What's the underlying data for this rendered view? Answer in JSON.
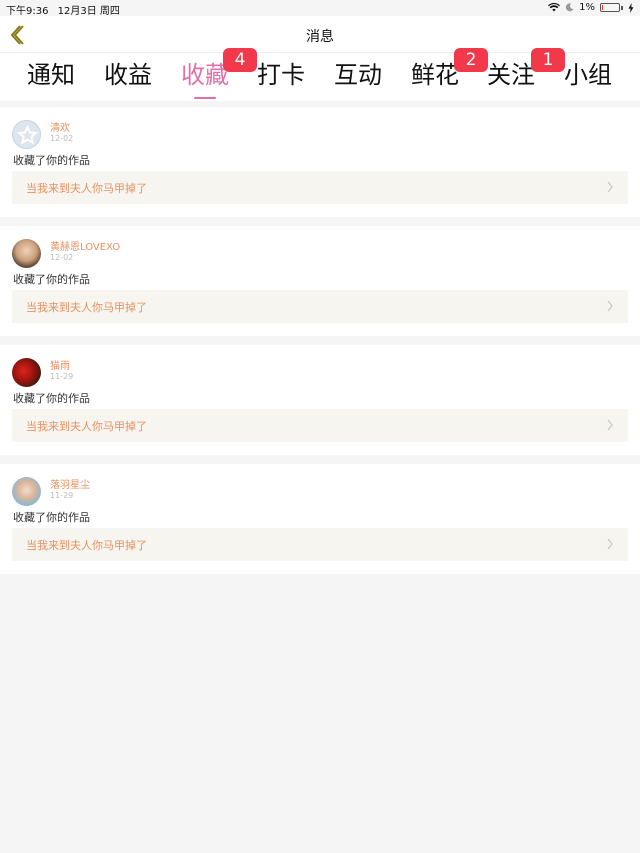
{
  "status": {
    "time": "下午9:36",
    "date": "12月3日 周四",
    "battery": "1%"
  },
  "nav": {
    "title": "消息"
  },
  "tabs": [
    {
      "label": "通知",
      "badge": null
    },
    {
      "label": "收益",
      "badge": null
    },
    {
      "label": "收藏",
      "badge": "4",
      "active": true
    },
    {
      "label": "打卡",
      "badge": null
    },
    {
      "label": "互动",
      "badge": null
    },
    {
      "label": "鲜花",
      "badge": "2"
    },
    {
      "label": "关注",
      "badge": "1"
    },
    {
      "label": "小组",
      "badge": null
    }
  ],
  "notifications": [
    {
      "user": "清欢",
      "time": "12-02",
      "action": "收藏了你的作品",
      "work": "当我来到夫人你马甲掉了",
      "avatar": "default-star-avatar"
    },
    {
      "user": "黄赫恩LOVEXO",
      "time": "12-02",
      "action": "收藏了你的作品",
      "work": "当我来到夫人你马甲掉了",
      "avatar": "photo-avatar"
    },
    {
      "user": "猫雨",
      "time": "11-29",
      "action": "收藏了你的作品",
      "work": "当我来到夫人你马甲掉了",
      "avatar": "photo-avatar"
    },
    {
      "user": "落羽星尘",
      "time": "11-29",
      "action": "收藏了你的作品",
      "work": "当我来到夫人你马甲掉了",
      "avatar": "photo-avatar"
    }
  ],
  "colors": {
    "accent": "#e46fa8",
    "badge": "#f2394c",
    "name": "#e89060"
  }
}
